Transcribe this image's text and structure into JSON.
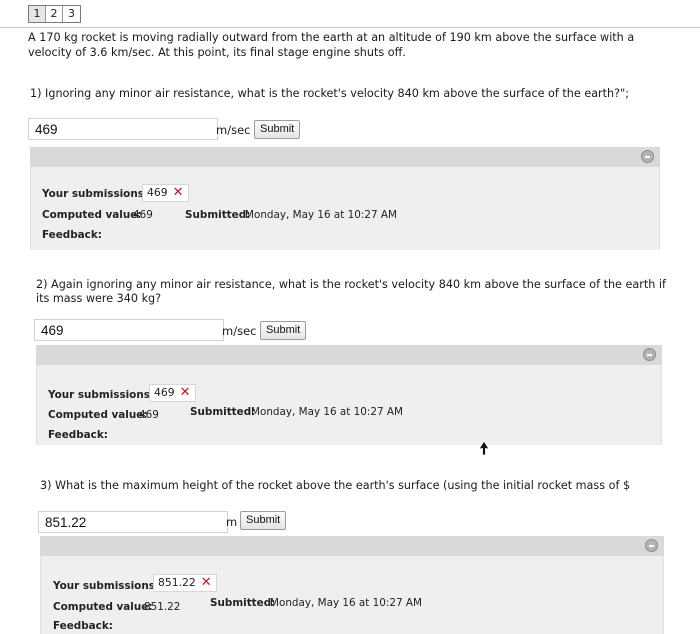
{
  "pager": {
    "pages": [
      "1",
      "2",
      "3"
    ],
    "active": 0
  },
  "problem": {
    "intro": "A 170 kg rocket is moving radially outward from the earth at an altitude of 190 km above the surface with a velocity of 3.6 km/sec. At this point, its final stage engine shuts off."
  },
  "questions": [
    {
      "text": "1) Ignoring any minor air resistance, what is the rocket's velocity 840 km above the surface of the earth?\";",
      "answer": "469",
      "unit": "m/sec",
      "submit_label": "Submit",
      "submissions_label": "Your submissions:",
      "submission_value": "469",
      "computed_label": "Computed value:",
      "computed_value": "469",
      "submitted_label": "Submitted:",
      "submitted_value": "Monday, May 16 at 10:27 AM",
      "feedback_label": "Feedback:"
    },
    {
      "text": "2) Again ignoring any minor air resistance, what is the rocket's velocity 840 km above the surface of the earth if its mass were 340 kg?",
      "answer": "469",
      "unit": "m/sec",
      "submit_label": "Submit",
      "submissions_label": "Your submissions:",
      "submission_value": "469",
      "computed_label": "Computed value:",
      "computed_value": "469",
      "submitted_label": "Submitted:",
      "submitted_value": "Monday, May 16 at 10:27 AM",
      "feedback_label": "Feedback:"
    },
    {
      "text": "3) What is the maximum height of the rocket above the earth's surface (using the initial rocket mass of $",
      "answer": "851.22",
      "unit": "m",
      "submit_label": "Submit",
      "submissions_label": "Your submissions:",
      "submission_value": "851.22",
      "computed_label": "Computed value:",
      "computed_value": "851.22",
      "submitted_label": "Submitted:",
      "submitted_value": "Monday, May 16 at 10:27 AM",
      "feedback_label": "Feedback:"
    }
  ],
  "icons": {
    "incorrect": "x-icon",
    "collapse": "collapse-icon",
    "cursor": "mouse-pointer-icon"
  },
  "colors": {
    "incorrect": "#d0101a",
    "panel_bar": "#d9d9d9",
    "panel_body": "#efefef"
  }
}
